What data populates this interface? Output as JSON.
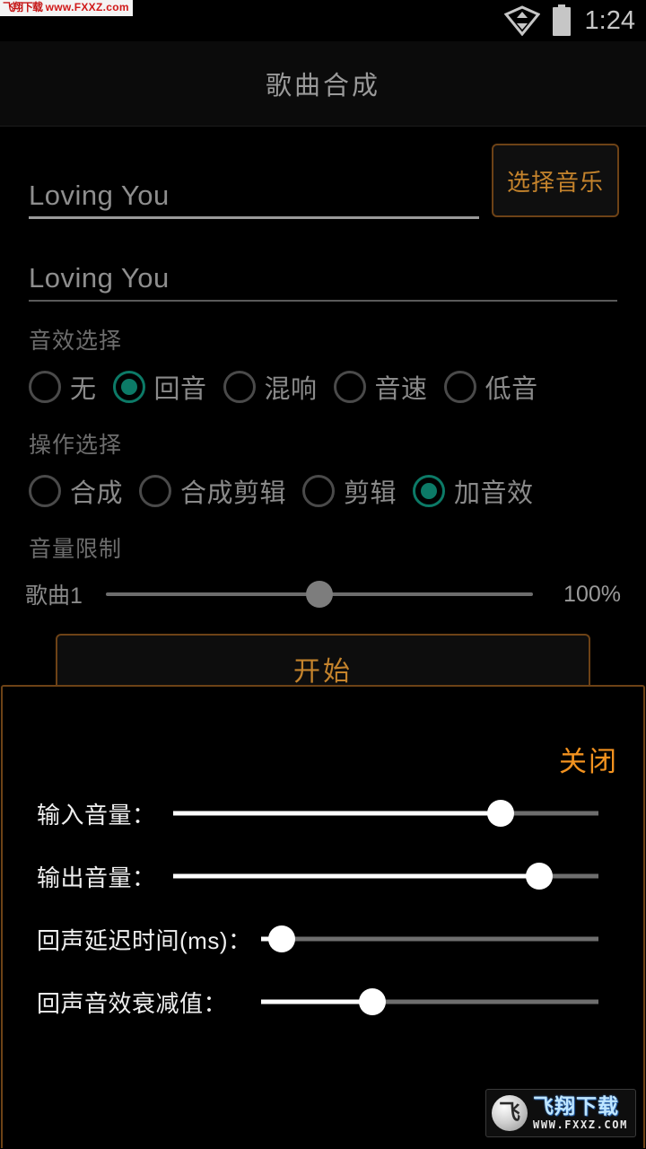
{
  "statusbar": {
    "watermark_cn": "飞翔下载",
    "watermark_url": "www.FXXZ.com",
    "clock": "1:24",
    "wifi_icon": "wifi-data-icon",
    "battery_icon": "battery-icon"
  },
  "titlebar": {
    "title": "歌曲合成"
  },
  "form": {
    "song_field_1": {
      "value": "Loving You"
    },
    "song_field_2": {
      "value": "Loving You"
    },
    "select_music_button": "选择音乐",
    "effect_group": {
      "label": "音效选择",
      "options": [
        {
          "label": "无",
          "selected": false
        },
        {
          "label": "回音",
          "selected": true
        },
        {
          "label": "混响",
          "selected": false
        },
        {
          "label": "音速",
          "selected": false
        },
        {
          "label": "低音",
          "selected": false
        }
      ]
    },
    "action_group": {
      "label": "操作选择",
      "options": [
        {
          "label": "合成",
          "selected": false
        },
        {
          "label": "合成剪辑",
          "selected": false
        },
        {
          "label": "剪辑",
          "selected": false
        },
        {
          "label": "加音效",
          "selected": true
        }
      ]
    },
    "volume_limit": {
      "label": "音量限制",
      "track_name": "歌曲1",
      "percent_label": "100%",
      "value": 50
    },
    "start_button": "开始"
  },
  "panel": {
    "close_button": "关闭",
    "sliders": [
      {
        "label": "输入音量：",
        "value": 77
      },
      {
        "label": "输出音量：",
        "value": 86
      },
      {
        "label": "回声延迟时间(ms)：",
        "value": 6
      },
      {
        "label": "回声音效衰减值：",
        "value": 33
      }
    ]
  },
  "logo": {
    "mark": "飞",
    "name_cn": "飞翔下载",
    "url": "WWW.FXXZ.COM"
  },
  "colors": {
    "accent_orange": "#c4832c",
    "close_orange": "#f2921f",
    "radio_selected": "#0c7a67",
    "panel_border": "#6d4216",
    "text_muted": "#8a8a8a"
  }
}
